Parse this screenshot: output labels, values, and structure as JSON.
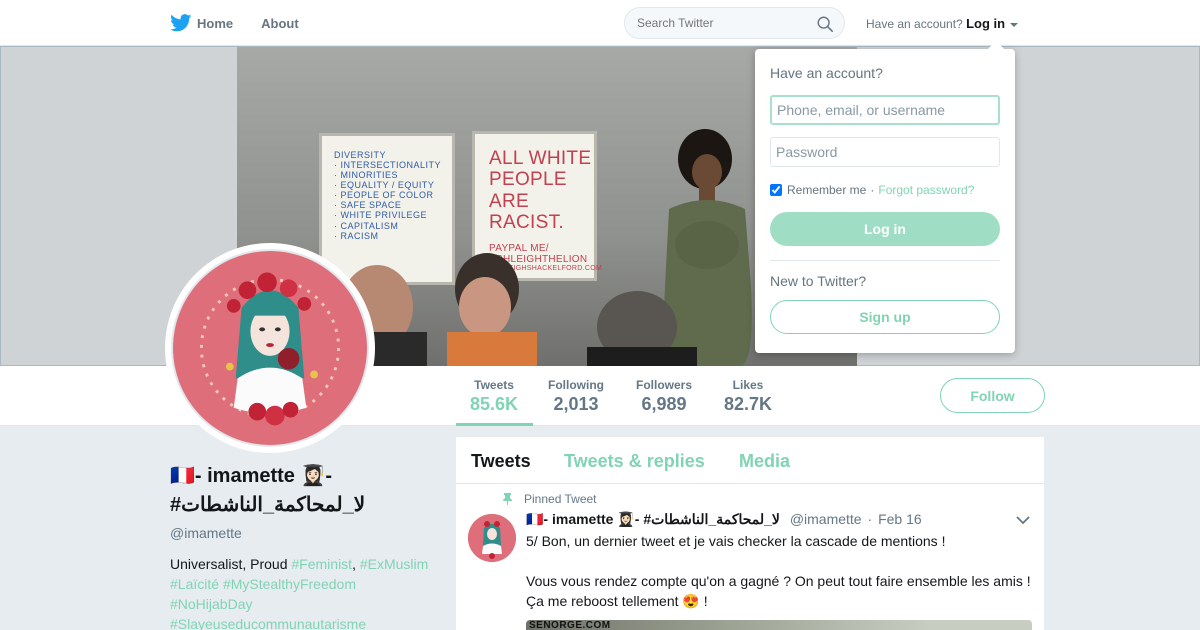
{
  "nav": {
    "home_label": "Home",
    "about_label": "About",
    "search_placeholder": "Search Twitter",
    "have_account_text": "Have an account?",
    "login_label": "Log in"
  },
  "banner": {
    "easel1_lines": [
      "DIVERSITY",
      "· INTERSECTIONALITY",
      "· MINORITIES",
      "· EQUALITY / EQUITY",
      "· PEOPLE OF COLOR",
      "· SAFE SPACE",
      "· WHITE PRIVILEGE",
      "· CAPITALISM",
      "· RACISM"
    ],
    "easel2_lines": [
      "ALL WHITE",
      "PEOPLE ARE",
      "RACIST."
    ],
    "easel2_small": [
      "PAYPAL ME/",
      "ASHLEIGHTHELION",
      "ASHLEIGHSHACKELFORD.COM"
    ]
  },
  "stats": {
    "tweets_label": "Tweets",
    "tweets_value": "85.6K",
    "following_label": "Following",
    "following_value": "2,013",
    "followers_label": "Followers",
    "followers_value": "6,989",
    "likes_label": "Likes",
    "likes_value": "82.7K",
    "follow_label": "Follow"
  },
  "profile": {
    "display_name": "🇫🇷- imamette 👩🏻‍🎓- #لا_لمحاكمة_الناشطات",
    "handle": "@imamette",
    "bio_text_1": "Universalist, Proud ",
    "bio_tag_1": "#Feminist",
    "bio_sep": ", ",
    "bio_tag_2": "#ExMuslim",
    "bio_tag_3": "#Laïcité",
    "bio_tag_4": "#MyStealthyFreedom",
    "bio_tag_5": "#NoHijabDay",
    "bio_tag_6": "#Slayeuseducommunautarisme"
  },
  "timeline": {
    "tabs": [
      {
        "label": "Tweets"
      },
      {
        "label": "Tweets & replies"
      },
      {
        "label": "Media"
      }
    ],
    "pinned_label": "Pinned Tweet",
    "tweet": {
      "name": "🇫🇷- imamette 👩🏻‍🎓- #لا_لمحاكمة_الناشطات",
      "handle": "@imamette",
      "date": "Feb 16",
      "line1": "5/ Bon, un dernier tweet et je vais checker la cascade de mentions !",
      "line2": "Vous vous rendez compte qu'on a gagné ? On peut tout faire ensemble les amis ! Ça me reboost tellement 😍 !",
      "media_text": "SENORGE.COM"
    }
  },
  "login_dropdown": {
    "title": "Have an account?",
    "username_placeholder": "Phone, email, or username",
    "password_placeholder": "Password",
    "remember_label": "Remember me",
    "separator": "·",
    "forgot_label": "Forgot password?",
    "login_button": "Log in",
    "new_label": "New to Twitter?",
    "signup_button": "Sign up"
  },
  "colors": {
    "accent": "#81d4b3",
    "text_secondary": "#657786",
    "background": "#e6ecf0",
    "avatar_bg": "#de6f7a"
  },
  "icons": {
    "logo": "twitter-bird-icon",
    "search": "search-icon",
    "pin": "pin-icon",
    "menu": "chevron-down-icon"
  }
}
